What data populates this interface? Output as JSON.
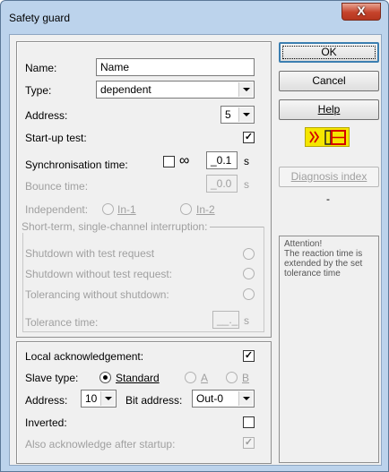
{
  "window": {
    "title": "Safety guard",
    "close_glyph": "X"
  },
  "form": {
    "name_label": "Name:",
    "name_value": "Name",
    "type_label": "Type:",
    "type_value": "dependent",
    "address_label": "Address:",
    "address_value": "5",
    "startup_test_label": "Start-up test:",
    "startup_test_checked": true,
    "sync_time_label": "Synchronisation time:",
    "sync_infinity": "∞",
    "sync_time_value": "_0.1",
    "sync_time_unit": "s",
    "bounce_label": "Bounce time:",
    "bounce_value": "_0.0",
    "bounce_unit": "s",
    "independent_label": "Independent:",
    "independent_in1": "In-1",
    "independent_in2": "In-2",
    "group_title": "Short-term, single-channel interruption:",
    "shutdown_with_test": "Shutdown with test request",
    "shutdown_without_test": "Shutdown without test request:",
    "tolerancing": "Tolerancing without shutdown:",
    "tolerance_label": "Tolerance time:",
    "tolerance_value": "__._",
    "tolerance_unit": "s"
  },
  "ack": {
    "local_ack_label": "Local acknowledgement:",
    "local_ack_checked": true,
    "slave_type_label": "Slave type:",
    "slave_standard": "Standard",
    "slave_a": "A",
    "slave_b": "B",
    "address_label": "Address:",
    "address_value": "10",
    "bit_address_label": "Bit address:",
    "bit_address_value": "Out-0",
    "inverted_label": "Inverted:",
    "also_ack_label": "Also acknowledge after startup:"
  },
  "buttons": {
    "ok": "OK",
    "cancel": "Cancel",
    "help": "Help",
    "diagnosis_index": "Diagnosis index",
    "dash": "-"
  },
  "note": {
    "text": "Attention!\nThe reaction time is extended by the set tolerance time"
  },
  "colors": {
    "title_bg": "#bcd3ec",
    "close_btn": "#c5432b",
    "icon_yellow": "#f5e600",
    "icon_red": "#d40000"
  },
  "icons": {
    "close": "close-icon",
    "safety_symbol": "safety-contact-icon"
  }
}
